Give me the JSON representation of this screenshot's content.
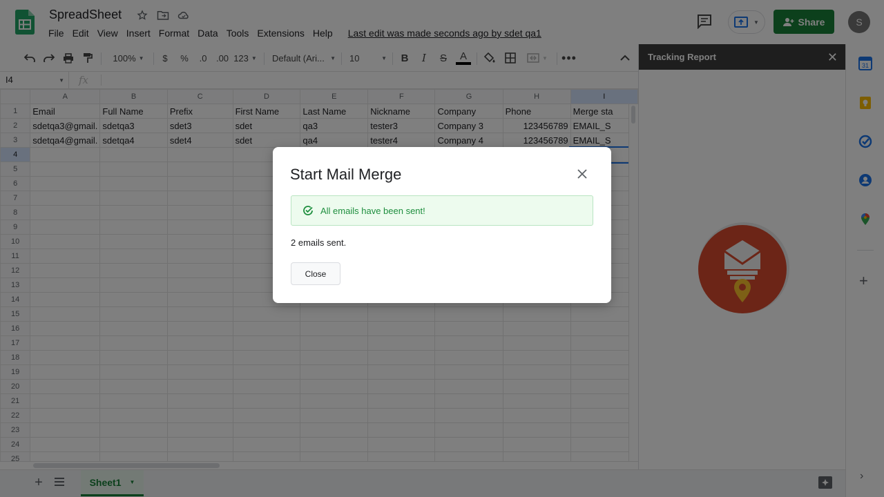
{
  "app": {
    "title": "SpreadSheet",
    "menu": [
      "File",
      "Edit",
      "View",
      "Insert",
      "Format",
      "Data",
      "Tools",
      "Extensions",
      "Help"
    ],
    "last_edit": "Last edit was made seconds ago by sdet qa1",
    "share_label": "Share",
    "avatar_initial": "S",
    "brand_color": "#188038"
  },
  "toolbar": {
    "zoom": "100%",
    "currency": "$",
    "percent": "%",
    "decimal_decrease": ".0",
    "decimal_increase": ".00",
    "more_formats": "123",
    "font": "Default (Ari...",
    "font_size": "10"
  },
  "formula_bar": {
    "cell_ref": "I4",
    "fx": "fx"
  },
  "grid": {
    "columns": [
      "A",
      "B",
      "C",
      "D",
      "E",
      "F",
      "G",
      "H",
      "I"
    ],
    "rows": [
      {
        "num": "1",
        "cells": [
          "Email",
          "Full Name",
          "Prefix",
          "First Name",
          "Last Name",
          "Nickname",
          "Company",
          "Phone",
          "Merge sta"
        ]
      },
      {
        "num": "2",
        "cells": [
          "sdetqa3@gmail.",
          "sdetqa3",
          "sdet3",
          "sdet",
          "qa3",
          "tester3",
          "Company 3",
          "123456789",
          "EMAIL_S"
        ]
      },
      {
        "num": "3",
        "cells": [
          "sdetqa4@gmail.",
          "sdetqa4",
          "sdet4",
          "sdet",
          "qa4",
          "tester4",
          "Company 4",
          "123456789",
          "EMAIL_S"
        ]
      }
    ],
    "empty_rows": [
      "4",
      "5",
      "6",
      "7",
      "8",
      "9",
      "10",
      "11",
      "12",
      "13",
      "14",
      "15",
      "16",
      "17",
      "18",
      "19",
      "20",
      "21",
      "22",
      "23",
      "24",
      "25"
    ]
  },
  "sheets": {
    "active": "Sheet1"
  },
  "side_panel": {
    "title": "Tracking Report",
    "close_icon": "close-icon",
    "logo_color": "#d84b2f"
  },
  "dialog": {
    "title": "Start Mail Merge",
    "alert": "All emails have been sent!",
    "message": "2 emails sent.",
    "close_button": "Close",
    "success_color": "#1e8e3e"
  }
}
